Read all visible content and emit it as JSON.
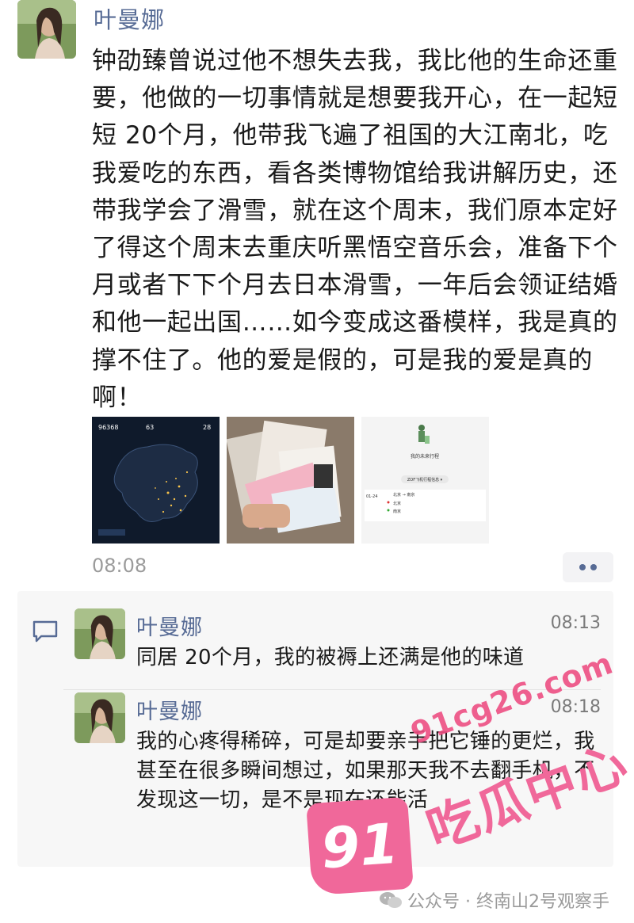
{
  "post": {
    "author": "叶曼娜",
    "text": "钟劭臻曾说过他不想失去我，我比他的生命还重要，他做的一切事情就是想要我开心，在一起短短 20个月，他带我飞遍了祖国的大江南北，吃我爱吃的东西，看各类博物馆给我讲解历史，还带我学会了滑雪，就在这个周末，我们原本定好了得这个周末去重庆听黑悟空音乐会，准备下个月或者下下个月去日本滑雪，一年后会领证结婚和他一起出国……如今变成这番模样，我是真的撑不住了。他的爱是假的，可是我的爱是真的啊！",
    "time": "08:08",
    "images": [
      {
        "name": "travel-map-image",
        "stat1": "96368",
        "stat2": "63",
        "stat3": "28"
      },
      {
        "name": "tickets-photo-image"
      },
      {
        "name": "itinerary-screenshot-image",
        "title": "我的未来行程",
        "button": "ZOF飞机行程信息 ▾",
        "date": "01-24",
        "route": "北京 → 南京",
        "from": "北京",
        "to": "南京"
      }
    ]
  },
  "comments": [
    {
      "author": "叶曼娜",
      "time": "08:13",
      "text": "同居 20个月，我的被褥上还满是他的味道"
    },
    {
      "author": "叶曼娜",
      "time": "08:18",
      "text": "我的心疼得稀碎，可是却要亲手把它锤的更烂，我甚至在很多瞬间想过，如果那天我不去翻手机，不发现这一切，是不是现在还能活"
    }
  ],
  "watermark": {
    "site": "91cg26.com",
    "logo": "91",
    "brand": "吃瓜中心",
    "color": "#f0689a"
  },
  "footer": {
    "text": "公众号 · 终南山2号观察手"
  },
  "colors": {
    "name": "#576b95",
    "comment_bg": "#f7f7f7",
    "time": "#9b9b9b"
  }
}
